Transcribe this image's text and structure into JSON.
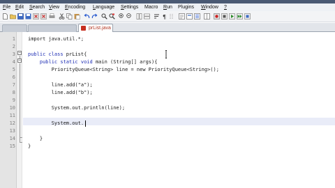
{
  "menu": {
    "items": [
      {
        "mnemonic": "F",
        "rest": "ile"
      },
      {
        "mnemonic": "E",
        "rest": "dit"
      },
      {
        "mnemonic": "S",
        "rest": "earch"
      },
      {
        "mnemonic": "V",
        "rest": "iew"
      },
      {
        "mnemonic": "E",
        "rest": "ncoding"
      },
      {
        "mnemonic": "L",
        "rest": "anguage"
      },
      {
        "mnemonic": "S",
        "rest": "ettings"
      },
      {
        "mnemonic": "",
        "rest": "Macro"
      },
      {
        "mnemonic": "R",
        "rest": "un"
      },
      {
        "mnemonic": "",
        "rest": "Plugins"
      },
      {
        "mnemonic": "W",
        "rest": "indow"
      },
      {
        "mnemonic": "?",
        "rest": ""
      }
    ]
  },
  "tabs": {
    "active": "prList.java"
  },
  "editor": {
    "lines": [
      {
        "num": "1",
        "code": "import java.util.*;"
      },
      {
        "num": "2",
        "code": ""
      },
      {
        "num": "3",
        "kw": "public class ",
        "code": "prList{"
      },
      {
        "num": "4",
        "kw": "    public static void ",
        "code": "main (String[] args){"
      },
      {
        "num": "5",
        "code": "        PriorityQueue<String> line = new PriorityQueue<String>();"
      },
      {
        "num": "6",
        "code": ""
      },
      {
        "num": "7",
        "code": "        line.add(\"a\");"
      },
      {
        "num": "8",
        "code": "        line.add(\"b\");"
      },
      {
        "num": "9",
        "code": ""
      },
      {
        "num": "10",
        "code": "        System.out.println(line);"
      },
      {
        "num": "11",
        "code": ""
      },
      {
        "num": "12",
        "code": "        System.out."
      },
      {
        "num": "13",
        "code": ""
      },
      {
        "num": "14",
        "code": "    }"
      },
      {
        "num": "15",
        "code": "}"
      }
    ]
  },
  "colors": {
    "keyword": "#1f2fb5",
    "tab_active_text": "#b0331e",
    "current_line": "#e9ecf8"
  }
}
